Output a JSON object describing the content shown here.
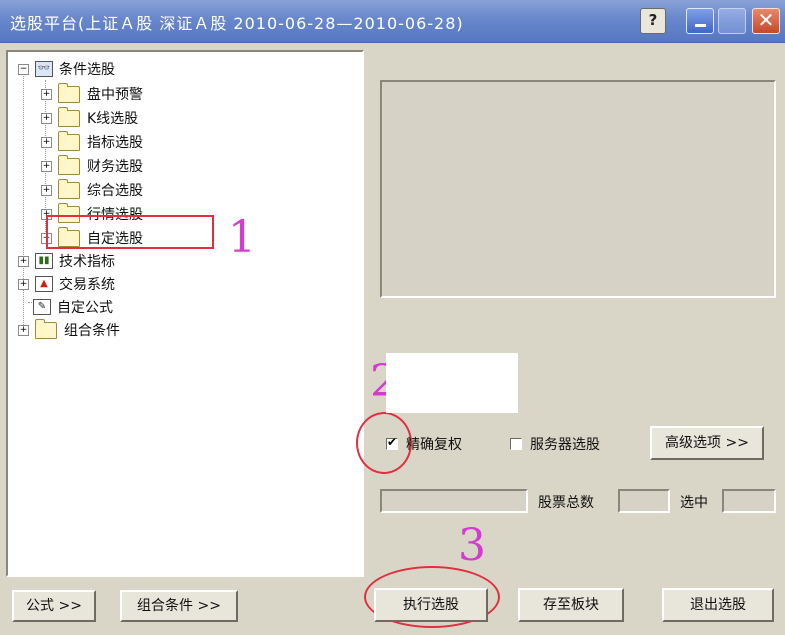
{
  "window": {
    "title": "选股平台(上证Ａ股 深证Ａ股  2010-06-28—2010-06-28)",
    "help_glyph": "?",
    "close_glyph": "✕"
  },
  "tree": {
    "root": "条件选股",
    "children": [
      "盘中预警",
      "K线选股",
      "指标选股",
      "财务选股",
      "综合选股",
      "行情选股",
      "自定选股"
    ],
    "top_items": [
      "技术指标",
      "交易系统",
      "自定公式",
      "组合条件"
    ]
  },
  "annotations": {
    "n1": "1",
    "n2": "2",
    "n3": "3",
    "color": "#d23ccf"
  },
  "options": {
    "precise_restore_label": "精确复权",
    "precise_restore_checked": true,
    "server_select_label": "服务器选股",
    "server_select_checked": false,
    "advanced_label": "高级选项 >>"
  },
  "stats": {
    "total_label": "股票总数",
    "selected_label": "选中"
  },
  "bottom": {
    "formula_label": "公式 >>",
    "combo_label": "组合条件 >>",
    "execute_label": "执行选股",
    "save_label": "存至板块",
    "exit_label": "退出选股"
  },
  "expander_glyphs": {
    "plus": "+",
    "minus": "−"
  },
  "icons": {
    "binoculars": "👓",
    "bars": "▮▮",
    "arrow": "▲",
    "pencil": "✎"
  }
}
